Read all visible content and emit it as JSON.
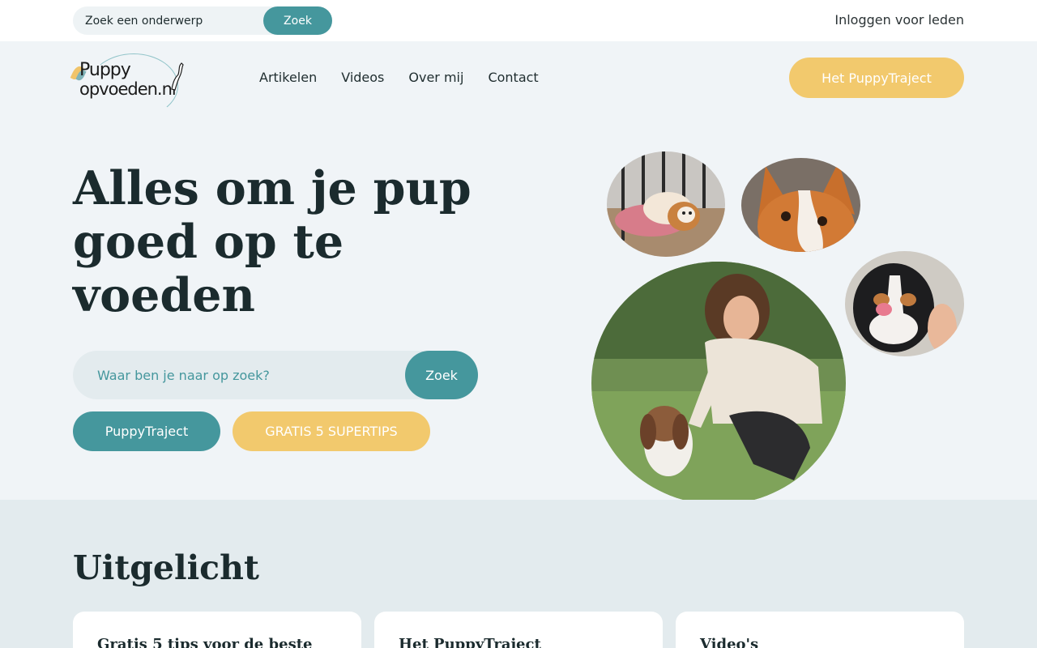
{
  "topbar": {
    "search_placeholder": "Zoek een onderwerp",
    "search_button": "Zoek",
    "login": "Inloggen voor leden"
  },
  "logo": {
    "line1": "Puppy",
    "line2": "opvoeden.nl"
  },
  "nav": {
    "items": [
      "Artikelen",
      "Videos",
      "Over mij",
      "Contact"
    ]
  },
  "header_cta": "Het PuppyTraject",
  "hero": {
    "title": "Alles om je pup goed op te voeden",
    "search_placeholder": "Waar ben je naar op zoek?",
    "search_button": "Zoek",
    "button_primary": "PuppyTraject",
    "button_secondary": "GRATIS 5 SUPERTIPS"
  },
  "featured": {
    "heading": "Uitgelicht",
    "cards": [
      "Gratis 5 tips voor de beste",
      "Het PuppyTraject",
      "Video's"
    ]
  },
  "colors": {
    "teal": "#45979d",
    "yellow": "#f2c96d",
    "background": "#f0f4f7",
    "section": "#e3ebee"
  }
}
